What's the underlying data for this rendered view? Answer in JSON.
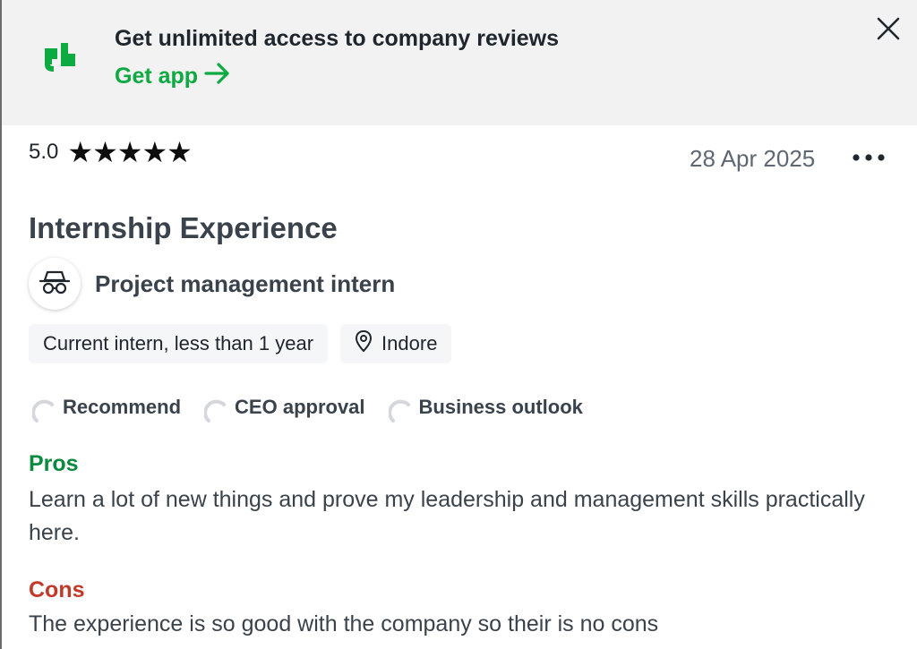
{
  "banner": {
    "logo_icon": "glassdoor-logo-icon",
    "title": "Get unlimited access to company reviews",
    "cta_label": "Get app",
    "cta_icon": "arrow-right-icon",
    "close_icon": "close-icon",
    "brand_color": "#0caa41"
  },
  "review": {
    "rating": "5.0",
    "stars": "★★★★★",
    "star_count": 5,
    "date": "28 Apr 2025",
    "more_icon": "more-horizontal-icon",
    "title": "Internship Experience",
    "job": {
      "icon": "incognito-icon",
      "title": "Project management intern"
    },
    "chips": [
      {
        "label": "Current intern, less than 1 year"
      },
      {
        "icon": "location-pin-icon",
        "label": "Indore"
      }
    ],
    "indicators": [
      {
        "icon": "loading-ring-icon",
        "label": "Recommend"
      },
      {
        "icon": "loading-ring-icon",
        "label": "CEO approval"
      },
      {
        "icon": "loading-ring-icon",
        "label": "Business outlook"
      }
    ],
    "pros": {
      "label": "Pros",
      "text": "Learn a lot of new things and prove my leadership and management skills practically here.",
      "color": "#0a8a3f"
    },
    "cons": {
      "label": "Cons",
      "text": "The experience is so good with the company so their is no cons",
      "color": "#c0392b"
    }
  }
}
